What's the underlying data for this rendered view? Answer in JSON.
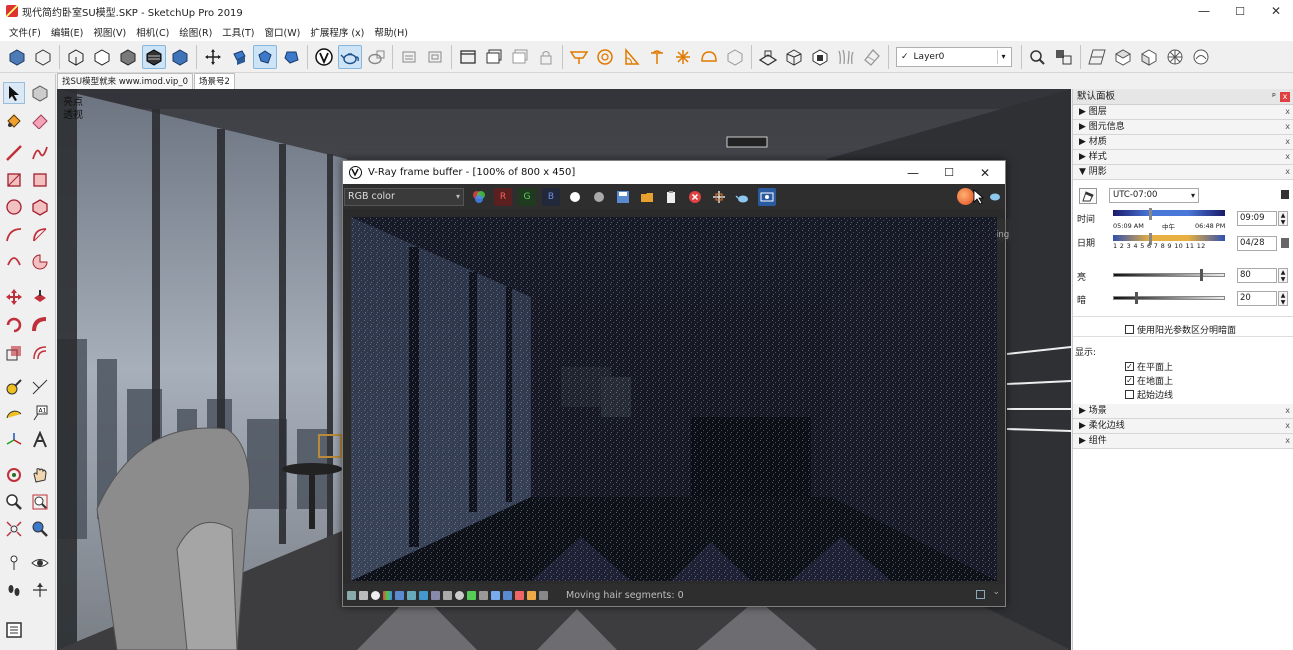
{
  "window": {
    "title": "现代简约卧室SU模型.SKP - SketchUp Pro 2019",
    "minimize": "—",
    "maximize": "☐",
    "close": "✕"
  },
  "menu": [
    "文件(F)",
    "编辑(E)",
    "视图(V)",
    "相机(C)",
    "绘图(R)",
    "工具(T)",
    "窗口(W)",
    "扩展程序 (x)",
    "帮助(H)"
  ],
  "layer_select": {
    "check": "✓",
    "value": "Layer0",
    "arrow": "▾"
  },
  "tabs": [
    "找SU模型就来 www.imod.vip_0",
    "场景号2"
  ],
  "viewport": {
    "label_line1": "亮点",
    "label_line2": "透视"
  },
  "tray": {
    "title": "默认面板",
    "pin": "ᵖ",
    "close": "x",
    "sections_top": [
      {
        "arrow": "▶",
        "label": "图层"
      },
      {
        "arrow": "▶",
        "label": "图元信息"
      },
      {
        "arrow": "▶",
        "label": "材质"
      },
      {
        "arrow": "▶",
        "label": "样式"
      },
      {
        "arrow": "▼",
        "label": "阴影"
      }
    ],
    "shadows": {
      "timezone": "UTC-07:00",
      "time_label": "时间",
      "time_start": "05:09 AM",
      "time_mid": "中午",
      "time_end": "06:48 PM",
      "time_value": "09:09",
      "date_label": "日期",
      "months": "1 2 3 4 5 6 7 8 9 10 11 12",
      "date_value": "04/28",
      "light_label": "亮",
      "light_value": "80",
      "light_level": 0.8,
      "dark_label": "暗",
      "dark_value": "20",
      "dark_level": 0.2,
      "use_sun_label": "使用阳光参数区分明暗面",
      "use_sun_checked": false,
      "display_label": "显示:",
      "on_faces_label": "在平面上",
      "on_faces_checked": true,
      "on_ground_label": "在地面上",
      "on_ground_checked": true,
      "from_edges_label": "起始边线",
      "from_edges_checked": false
    },
    "sections_bottom": [
      {
        "arrow": "▶",
        "label": "场景"
      },
      {
        "arrow": "▶",
        "label": "柔化边线"
      },
      {
        "arrow": "▶",
        "label": "组件"
      }
    ]
  },
  "vfb": {
    "title": "V-Ray frame buffer - [100% of 800 x 450]",
    "minimize": "—",
    "maximize": "☐",
    "close": "✕",
    "channel": "RGB color",
    "channel_arrow": "▾",
    "btn_r": "R",
    "btn_g": "G",
    "btn_b": "B",
    "tooltip": "Stop rendering",
    "status": "Moving hair segments: 0"
  }
}
